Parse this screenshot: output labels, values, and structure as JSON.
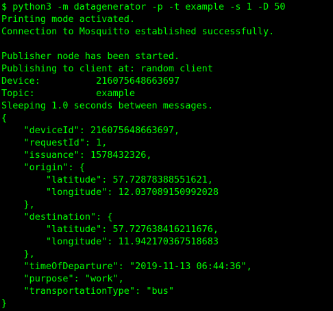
{
  "terminal": {
    "lines": [
      "$ python3 -m datagenerator -p -t example -s 1 -D 50",
      "Printing mode activated.",
      "Connection to Mosquitto established successfully.",
      "",
      "Publisher node has been started.",
      "Publishing to client at: random client",
      "Device:          216075648663697",
      "Topic:           example",
      "Sleeping 1.0 seconds between messages.",
      "{",
      "    \"deviceId\": 216075648663697,",
      "    \"requestId\": 1,",
      "    \"issuance\": 1578432326,",
      "    \"origin\": {",
      "        \"latitude\": 57.72878388551621,",
      "        \"longitude\": 12.037089150992028",
      "    },",
      "    \"destination\": {",
      "        \"latitude\": 57.727638416211676,",
      "        \"longitude\": 11.942170367518683",
      "    },",
      "    \"timeOfDeparture\": \"2019-11-13 06:44:36\",",
      "    \"purpose\": \"work\",",
      "    \"transportationType\": \"bus\"",
      "}"
    ]
  },
  "colors": {
    "background": "#000000",
    "text": "#00ff00"
  }
}
